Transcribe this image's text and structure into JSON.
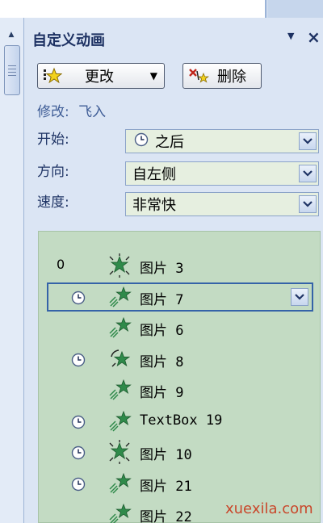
{
  "pane": {
    "title": "自定义动画",
    "menu_icon": "chevron-down-icon",
    "close_icon": "close-icon"
  },
  "toolbar": {
    "change_label": "更改",
    "delete_label": "删除"
  },
  "modify": {
    "label": "修改:",
    "effect": "飞入"
  },
  "fields": [
    {
      "label": "开始:",
      "value": "之后",
      "icon": "clock-icon"
    },
    {
      "label": "方向:",
      "value": "自左侧"
    },
    {
      "label": "速度:",
      "value": "非常快"
    }
  ],
  "animations": [
    {
      "index": "0",
      "effect_icon": "star-burst-icon",
      "name": "图片 3",
      "timing": ""
    },
    {
      "index": "",
      "effect_icon": "fly-in-star-icon",
      "name": "图片 7",
      "timing": "after-previous",
      "selected": true
    },
    {
      "index": "",
      "effect_icon": "fly-in-star-icon",
      "name": "图片 6",
      "timing": ""
    },
    {
      "index": "",
      "effect_icon": "spin-star-icon",
      "name": "图片 8",
      "timing": "after-previous"
    },
    {
      "index": "",
      "effect_icon": "fly-in-star-icon",
      "name": "图片 9",
      "timing": ""
    },
    {
      "index": "",
      "effect_icon": "fly-in-star-icon",
      "name": "TextBox 19",
      "timing": "after-previous"
    },
    {
      "index": "",
      "effect_icon": "star-burst-icon",
      "name": "图片 10",
      "timing": "after-previous"
    },
    {
      "index": "",
      "effect_icon": "fly-in-star-icon",
      "name": "图片 21",
      "timing": "after-previous"
    },
    {
      "index": "",
      "effect_icon": "fly-in-star-icon",
      "name": "图片 22",
      "timing": ""
    }
  ],
  "watermark": "xuexila.com",
  "colors": {
    "pane_bg": "#dbe5f4",
    "list_bg": "#c3dbc3",
    "title": "#1d3162",
    "star_green": "#2f8a4a"
  }
}
